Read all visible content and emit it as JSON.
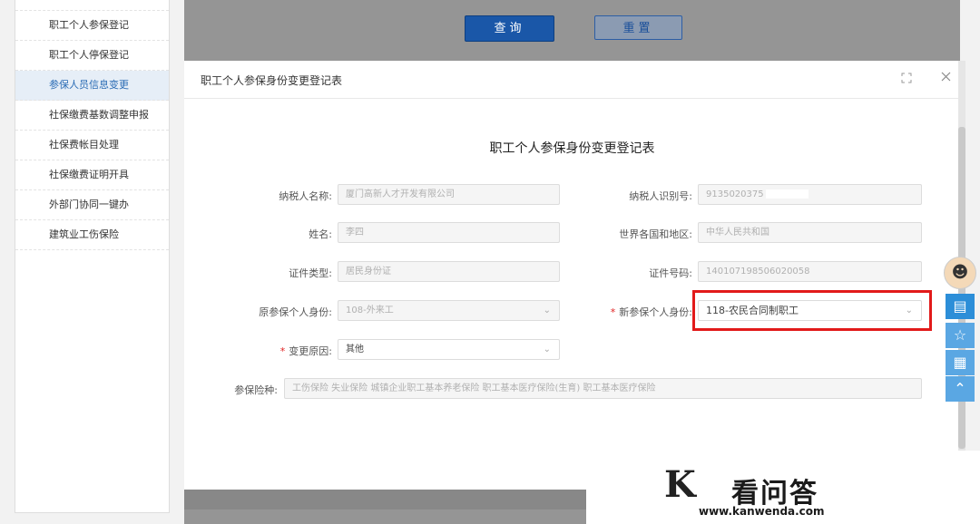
{
  "sidebar": {
    "items": [
      {
        "label": "职工个人参保登记"
      },
      {
        "label": "职工个人停保登记"
      },
      {
        "label": "参保人员信息变更"
      },
      {
        "label": "社保缴费基数调整申报"
      },
      {
        "label": "社保费帐目处理"
      },
      {
        "label": "社保缴费证明开具"
      },
      {
        "label": "外部门协同一键办"
      },
      {
        "label": "建筑业工伤保险"
      }
    ]
  },
  "toolbar": {
    "query_label": "查询",
    "reset_label": "重置"
  },
  "modal": {
    "header_title": "职工个人参保身份变更登记表",
    "form_title": "职工个人参保身份变更登记表",
    "fields": {
      "taxpayer_name": {
        "label": "纳税人名称:",
        "value": "厦门高新人才开发有限公司"
      },
      "taxpayer_id": {
        "label": "纳税人识别号:",
        "value": "9135020375"
      },
      "name": {
        "label": "姓名:",
        "value": "李四"
      },
      "country": {
        "label": "世界各国和地区:",
        "value": "中华人民共和国"
      },
      "id_type": {
        "label": "证件类型:",
        "value": "居民身份证"
      },
      "id_number": {
        "label": "证件号码:",
        "value": "140107198506020058"
      },
      "old_identity": {
        "label": "原参保个人身份:",
        "value": "108-外来工"
      },
      "new_identity": {
        "label": "新参保个人身份:",
        "value": "118-农民合同制职工"
      },
      "change_reason": {
        "label": "变更原因:",
        "value": "其他"
      },
      "insurance_types": {
        "label": "参保险种:",
        "value": "工伤保险 失业保险 城镇企业职工基本养老保险 职工基本医疗保险(生育) 职工基本医疗保险"
      }
    },
    "required_mark": "*"
  },
  "watermark": {
    "name": "看问答",
    "url": "www.kanwenda.com"
  },
  "colors": {
    "primary": "#1a57a8",
    "active_sidebar": "#2b6cb5",
    "highlight": "#e21a1a",
    "float_tool": "#5aa7e3"
  }
}
